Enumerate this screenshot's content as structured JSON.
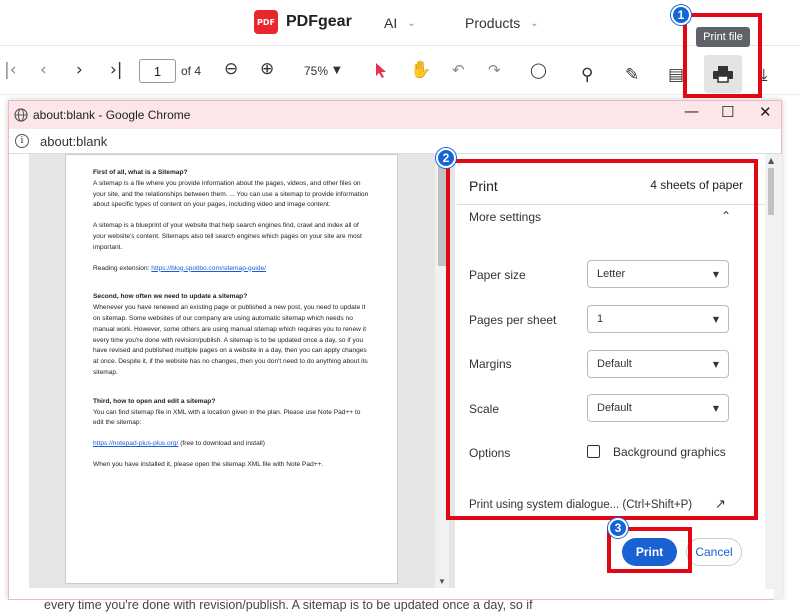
{
  "app": {
    "logo_mark": "PDF",
    "name": "PDFgear",
    "nav": [
      {
        "label": "AI"
      },
      {
        "label": "Products"
      }
    ]
  },
  "toolbar": {
    "page_current": "1",
    "page_total": "of 4",
    "zoom": "75%",
    "tooltip": "Print file"
  },
  "annotations": {
    "badge1": "1",
    "badge2": "2",
    "badge3": "3",
    "accent": "#e30613",
    "badge_color": "#1565d8"
  },
  "chrome": {
    "title": "about:blank - Google Chrome",
    "url": "about:blank"
  },
  "document": {
    "sections": [
      {
        "heading": "First of all, what is a Sitemap?",
        "paragraphs": [
          "A sitemap is a file where you provide information about the pages, videos, and other files on your site, and the relationships between them. ... You can use a sitemap to provide information about specific types of content on your pages, including video and image content.",
          "A sitemap is a blueprint of your website that help search engines find, crawl and index all of your website's content. Sitemaps also tell search engines which pages on your site are most important."
        ],
        "link_prefix": "Reading extension: ",
        "link": "https://blog.spotibo.com/sitemap-guide/"
      },
      {
        "heading": "Second, how often we need to update a sitemap?",
        "paragraphs": [
          "Whenever you have renewed an existing page or published a new post, you need to update it on sitemap. Some websites of our company are using automatic sitemap which needs no manual work. However, some others are using manual sitemap which requires you to renew it every time you're done with revision/publish. A sitemap is to be updated once a day, so if you have revised and published multiple pages on a website in a day, then you can apply changes at once. Despite it, if the website has no changes, then you don't need to do anything about its sitemap."
        ]
      },
      {
        "heading": "Third, how to open and edit a sitemap?",
        "paragraphs": [
          "You can find sitemap file in XML with a location given in the plan. Please use Note Pad++ to edit the sitemap:"
        ],
        "link": "https://notepad-plus-plus.org/",
        "link_suffix": " (free to download and install)",
        "closing": "When you have installed it, please open the sitemap XML file with Note Pad++."
      }
    ]
  },
  "print_panel": {
    "title": "Print",
    "sheets": "4 sheets of paper",
    "more_settings": "More settings",
    "paper_size_label": "Paper size",
    "paper_size_value": "Letter",
    "pages_per_sheet_label": "Pages per sheet",
    "pages_per_sheet_value": "1",
    "margins_label": "Margins",
    "margins_value": "Default",
    "scale_label": "Scale",
    "scale_value": "Default",
    "options_label": "Options",
    "background_graphics": "Background graphics",
    "background_graphics_checked": false,
    "system_dialog": "Print using system dialogue... (Ctrl+Shift+P)",
    "print_button": "Print",
    "cancel_button": "Cancel"
  },
  "background_text": "every time you're done with revision/publish. A sitemap is to be updated once a day, so if"
}
